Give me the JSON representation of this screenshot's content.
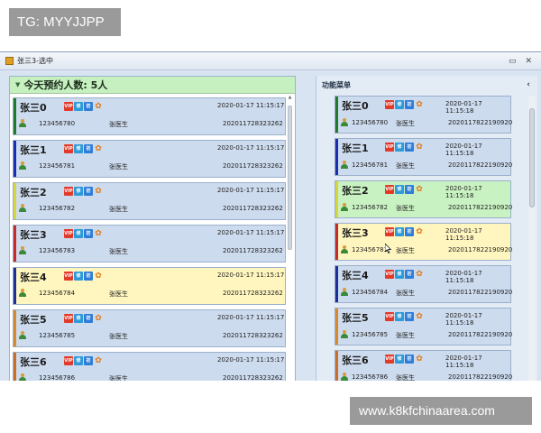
{
  "overlay_top": {
    "text": "TG: MYYJJPP"
  },
  "overlay_bottom": {
    "text": "www.k8kfchinaarea.com"
  },
  "window": {
    "title": "张三3-选中",
    "controls": [
      "▭",
      "✕"
    ]
  },
  "left_panel": {
    "header": "今天预约人数: 5人",
    "caret": "▼",
    "scroll_up": "▲",
    "cards": [
      {
        "name": "张三0",
        "time": "2020-01-17 11:15:17",
        "phone": "123456780",
        "doctor": "张医生",
        "code": "202011728323262",
        "stripe": "#1f7a2a",
        "bg": "#cddbee"
      },
      {
        "name": "张三1",
        "time": "2020-01-17 11:15:17",
        "phone": "123456781",
        "doctor": "张医生",
        "code": "202011728323262",
        "stripe": "#1a2fb0",
        "bg": "#cddbee"
      },
      {
        "name": "张三2",
        "time": "2020-01-17 11:15:17",
        "phone": "123456782",
        "doctor": "张医生",
        "code": "202011728323262",
        "stripe": "#d6d63a",
        "bg": "#cddbee"
      },
      {
        "name": "张三3",
        "time": "2020-01-17 11:15:17",
        "phone": "123456783",
        "doctor": "张医生",
        "code": "202011728323262",
        "stripe": "#c62a2a",
        "bg": "#cddbee"
      },
      {
        "name": "张三4",
        "time": "2020-01-17 11:15:17",
        "phone": "123456784",
        "doctor": "张医生",
        "code": "202011728323262",
        "stripe": "#1a2f9a",
        "bg": "#fff6bf"
      },
      {
        "name": "张三5",
        "time": "2020-01-17 11:15:17",
        "phone": "123456785",
        "doctor": "张医生",
        "code": "202011728323262",
        "stripe": "#d88a2a",
        "bg": "#cddbee"
      },
      {
        "name": "张三6",
        "time": "2020-01-17 11:15:17",
        "phone": "123456786",
        "doctor": "张医生",
        "code": "202011728323262",
        "stripe": "#c8702a",
        "bg": "#cddbee"
      }
    ]
  },
  "right_panel": {
    "header": "功能菜单",
    "collapse": "‹",
    "cards": [
      {
        "name": "张三0",
        "time": "2020-01-17 11:15:18",
        "phone": "123456780",
        "doctor": "张医生",
        "code": "2020117822190920",
        "stripe": "#1f7a2a",
        "bg": "#cddbee"
      },
      {
        "name": "张三1",
        "time": "2020-01-17 11:15:18",
        "phone": "123456781",
        "doctor": "张医生",
        "code": "2020117822190920",
        "stripe": "#1a2fb0",
        "bg": "#cddbee"
      },
      {
        "name": "张三2",
        "time": "2020-01-17 11:15:18",
        "phone": "123456782",
        "doctor": "张医生",
        "code": "2020117822190920",
        "stripe": "#d6d63a",
        "bg": "#c9f2c2"
      },
      {
        "name": "张三3",
        "time": "2020-01-17 11:15:18",
        "phone": "123456783",
        "doctor": "张医生",
        "code": "2020117822190920",
        "stripe": "#c62a2a",
        "bg": "#fff6bf"
      },
      {
        "name": "张三4",
        "time": "2020-01-17 11:15:18",
        "phone": "123456784",
        "doctor": "张医生",
        "code": "2020117822190920",
        "stripe": "#1a2f9a",
        "bg": "#cddbee"
      },
      {
        "name": "张三5",
        "time": "2020-01-17 11:15:18",
        "phone": "123456785",
        "doctor": "张医生",
        "code": "2020117822190920",
        "stripe": "#d88a2a",
        "bg": "#cddbee"
      },
      {
        "name": "张三6",
        "time": "2020-01-17 11:15:18",
        "phone": "123456786",
        "doctor": "张医生",
        "code": "2020117822190920",
        "stripe": "#c8702a",
        "bg": "#cddbee"
      }
    ]
  },
  "badges": {
    "vip": "VIP",
    "xiu": "修",
    "chu": "初",
    "leaf": "✿"
  }
}
